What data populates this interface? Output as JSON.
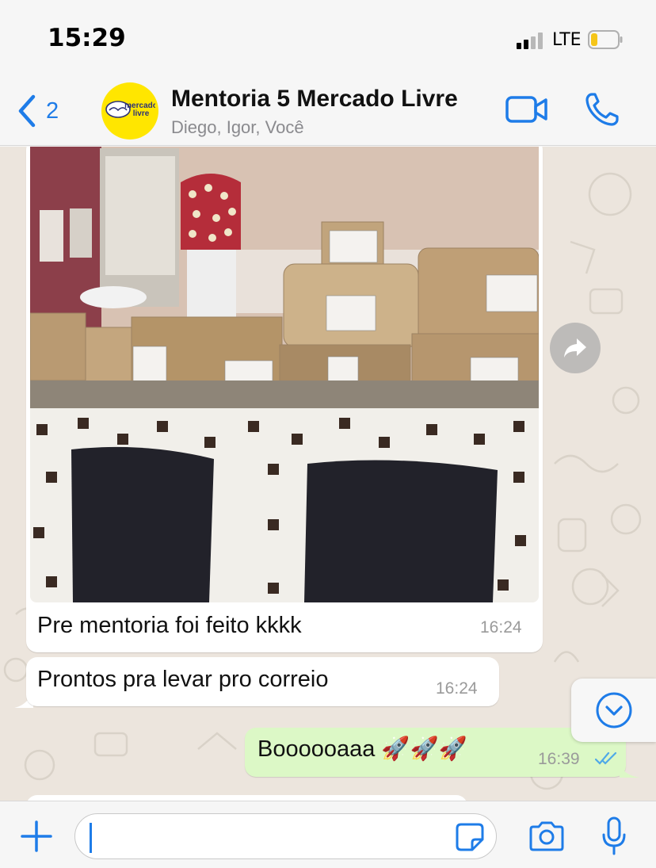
{
  "status_bar": {
    "time": "15:29",
    "network": "LTE",
    "battery_level": 0.2,
    "signal_bars": 2
  },
  "header": {
    "back_count": "2",
    "title": "Mentoria 5 Mercado Livre",
    "subtitle": "Diego, Igor, Você",
    "avatar_text_line1": "mercado",
    "avatar_text_line2": "livre",
    "accent_color": "#1e7ce8"
  },
  "messages": [
    {
      "type": "image",
      "direction": "in",
      "caption": "Pre mentoria foi feito kkkk",
      "time": "16:24"
    },
    {
      "type": "text",
      "direction": "in",
      "text": "Prontos pra levar pro correio",
      "time": "16:24"
    },
    {
      "type": "text",
      "direction": "out",
      "text": "Boooooaaa 🚀🚀🚀",
      "time": "16:39",
      "status": "read"
    }
  ],
  "input": {
    "value": "",
    "placeholder": ""
  },
  "icons": {
    "back": "chevron-left-icon",
    "video": "video-camera-icon",
    "phone": "phone-icon",
    "forward": "forward-arrow-icon",
    "scroll_down": "chevron-down-circle-icon",
    "attach": "plus-icon",
    "sticker": "sticker-icon",
    "camera": "camera-icon",
    "mic": "microphone-icon"
  }
}
